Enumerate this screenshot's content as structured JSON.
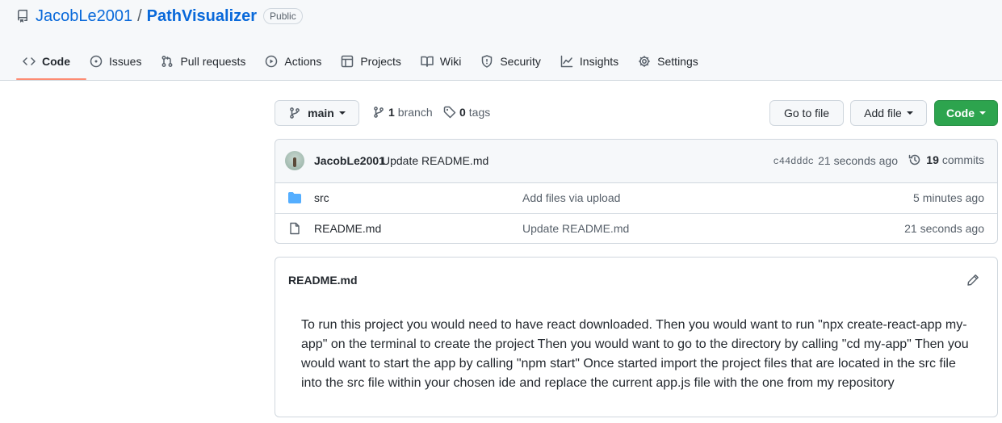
{
  "repo": {
    "owner": "JacobLe2001",
    "separator": "/",
    "name": "PathVisualizer",
    "visibility": "Public"
  },
  "tabs": [
    {
      "label": "Code",
      "icon": "code-icon",
      "active": true
    },
    {
      "label": "Issues",
      "icon": "issue-icon"
    },
    {
      "label": "Pull requests",
      "icon": "pull-request-icon"
    },
    {
      "label": "Actions",
      "icon": "play-icon"
    },
    {
      "label": "Projects",
      "icon": "table-icon"
    },
    {
      "label": "Wiki",
      "icon": "book-icon"
    },
    {
      "label": "Security",
      "icon": "shield-icon"
    },
    {
      "label": "Insights",
      "icon": "graph-icon"
    },
    {
      "label": "Settings",
      "icon": "gear-icon"
    }
  ],
  "toolbar": {
    "branch_select": "main",
    "branch_count": "1",
    "branch_label": "branch",
    "tag_count": "0",
    "tag_label": "tags",
    "go_to_file": "Go to file",
    "add_file": "Add file",
    "code": "Code"
  },
  "latest_commit": {
    "author": "JacobLe2001",
    "message": "Update README.md",
    "sha": "c44dddc",
    "time": "21 seconds ago",
    "commit_count": "19",
    "commit_label": "commits"
  },
  "files": [
    {
      "type": "folder",
      "name": "src",
      "message": "Add files via upload",
      "time": "5 minutes ago"
    },
    {
      "type": "file",
      "name": "README.md",
      "message": "Update README.md",
      "time": "21 seconds ago"
    }
  ],
  "readme": {
    "title": "README.md",
    "body": "To run this project you would need to have react downloaded. Then you would want to run \"npx create-react-app my-app\" on the terminal to create the project Then you would want to go to the directory by calling \"cd my-app\" Then you would want to start the app by calling \"npm start\" Once started import the project files that are located in the src file into the src file within your chosen ide and replace the current app.js file with the one from my repository"
  },
  "colors": {
    "link": "#0969da",
    "accent_underline": "#fd8c73",
    "green_button": "#2da44e",
    "folder": "#54aeff"
  }
}
